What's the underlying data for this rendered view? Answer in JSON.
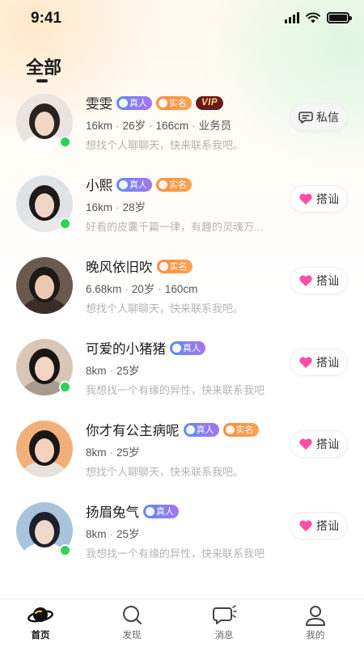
{
  "status": {
    "time": "9:41"
  },
  "section_title": "全部",
  "users": [
    {
      "name": "雯雯",
      "badges": [
        "real",
        "realname",
        "vip"
      ],
      "distance": "16km",
      "age": "26岁",
      "height": "166cm",
      "job": "业务员",
      "desc": "想找个人聊聊天，快来联系我吧。",
      "action": "私信",
      "action_type": "message",
      "online": true
    },
    {
      "name": "小熙",
      "badges": [
        "real",
        "realname"
      ],
      "distance": "16km",
      "age": "28岁",
      "height": "",
      "job": "",
      "desc": "好看的皮囊千篇一律，有趣的灵魂万...",
      "action": "搭讪",
      "action_type": "greet",
      "online": true
    },
    {
      "name": "晚风依旧吹",
      "badges": [
        "realname"
      ],
      "distance": "6.68km",
      "age": "20岁",
      "height": "160cm",
      "job": "",
      "desc": "想找个人聊聊天，快来联系我吧。",
      "action": "搭讪",
      "action_type": "greet",
      "online": false
    },
    {
      "name": "可爱的小猪猪",
      "badges": [
        "real"
      ],
      "distance": "8km",
      "age": "25岁",
      "height": "",
      "job": "",
      "desc": "我想找一个有缘的异性，快来联系我吧",
      "action": "搭讪",
      "action_type": "greet",
      "online": true
    },
    {
      "name": "你才有公主病呢",
      "badges": [
        "real",
        "realname"
      ],
      "distance": "8km",
      "age": "25岁",
      "height": "",
      "job": "",
      "desc": "想找个人聊聊天，快来联系我吧。",
      "action": "搭讪",
      "action_type": "greet",
      "online": false
    },
    {
      "name": "扬眉兔气",
      "badges": [
        "real"
      ],
      "distance": "8km",
      "age": "25岁",
      "height": "",
      "job": "",
      "desc": "我想找一个有缘的异性，快来联系我吧",
      "action": "搭讪",
      "action_type": "greet",
      "online": true
    }
  ],
  "badge_labels": {
    "real": "真人",
    "realname": "实名",
    "vip": "VIP"
  },
  "tabs": [
    {
      "label": "首页",
      "icon": "planet-icon",
      "active": true
    },
    {
      "label": "发现",
      "icon": "search-icon",
      "active": false
    },
    {
      "label": "消息",
      "icon": "chat-bubble-icon",
      "active": false
    },
    {
      "label": "我的",
      "icon": "person-icon",
      "active": false
    }
  ],
  "colors": {
    "online": "#2fd158",
    "heart": "#ff4fa3",
    "real_badge": "#5b8cf6",
    "realname_badge": "#ff8a3d",
    "vip_badge": "#6a1a1a"
  }
}
